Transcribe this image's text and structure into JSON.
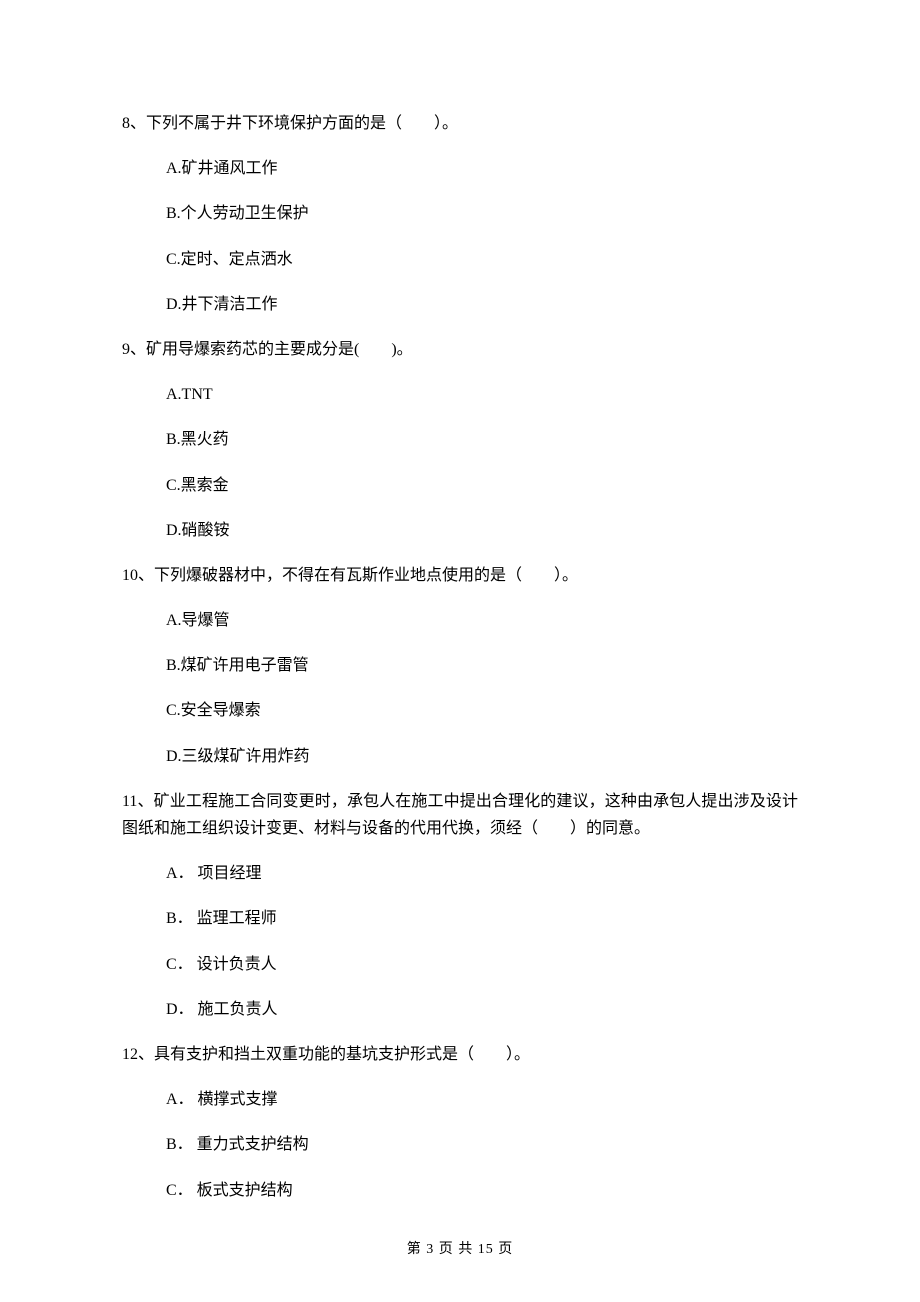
{
  "questions": [
    {
      "number": "8、",
      "stem": "下列不属于井下环境保护方面的是（　　）。",
      "options": [
        "A.矿井通风工作",
        "B.个人劳动卫生保护",
        "C.定时、定点洒水",
        "D.井下清洁工作"
      ]
    },
    {
      "number": "9、",
      "stem": "矿用导爆索药芯的主要成分是(　　)。",
      "options": [
        "A.TNT",
        "B.黑火药",
        "C.黑索金",
        "D.硝酸铵"
      ]
    },
    {
      "number": "10、",
      "stem": "下列爆破器材中，不得在有瓦斯作业地点使用的是（　　）。",
      "options": [
        "A.导爆管",
        "B.煤矿许用电子雷管",
        "C.安全导爆索",
        "D.三级煤矿许用炸药"
      ]
    },
    {
      "number": "11、",
      "stem": "矿业工程施工合同变更时，承包人在施工中提出合理化的建议，这种由承包人提出涉及设计图纸和施工组织设计变更、材料与设备的代用代换，须经（　　）的同意。",
      "options": [
        "A． 项目经理",
        "B． 监理工程师",
        "C． 设计负责人",
        "D． 施工负责人"
      ]
    },
    {
      "number": "12、",
      "stem": "具有支护和挡土双重功能的基坑支护形式是（　　）。",
      "options": [
        "A． 横撑式支撑",
        "B． 重力式支护结构",
        "C． 板式支护结构"
      ]
    }
  ],
  "footer": "第 3 页 共 15 页"
}
